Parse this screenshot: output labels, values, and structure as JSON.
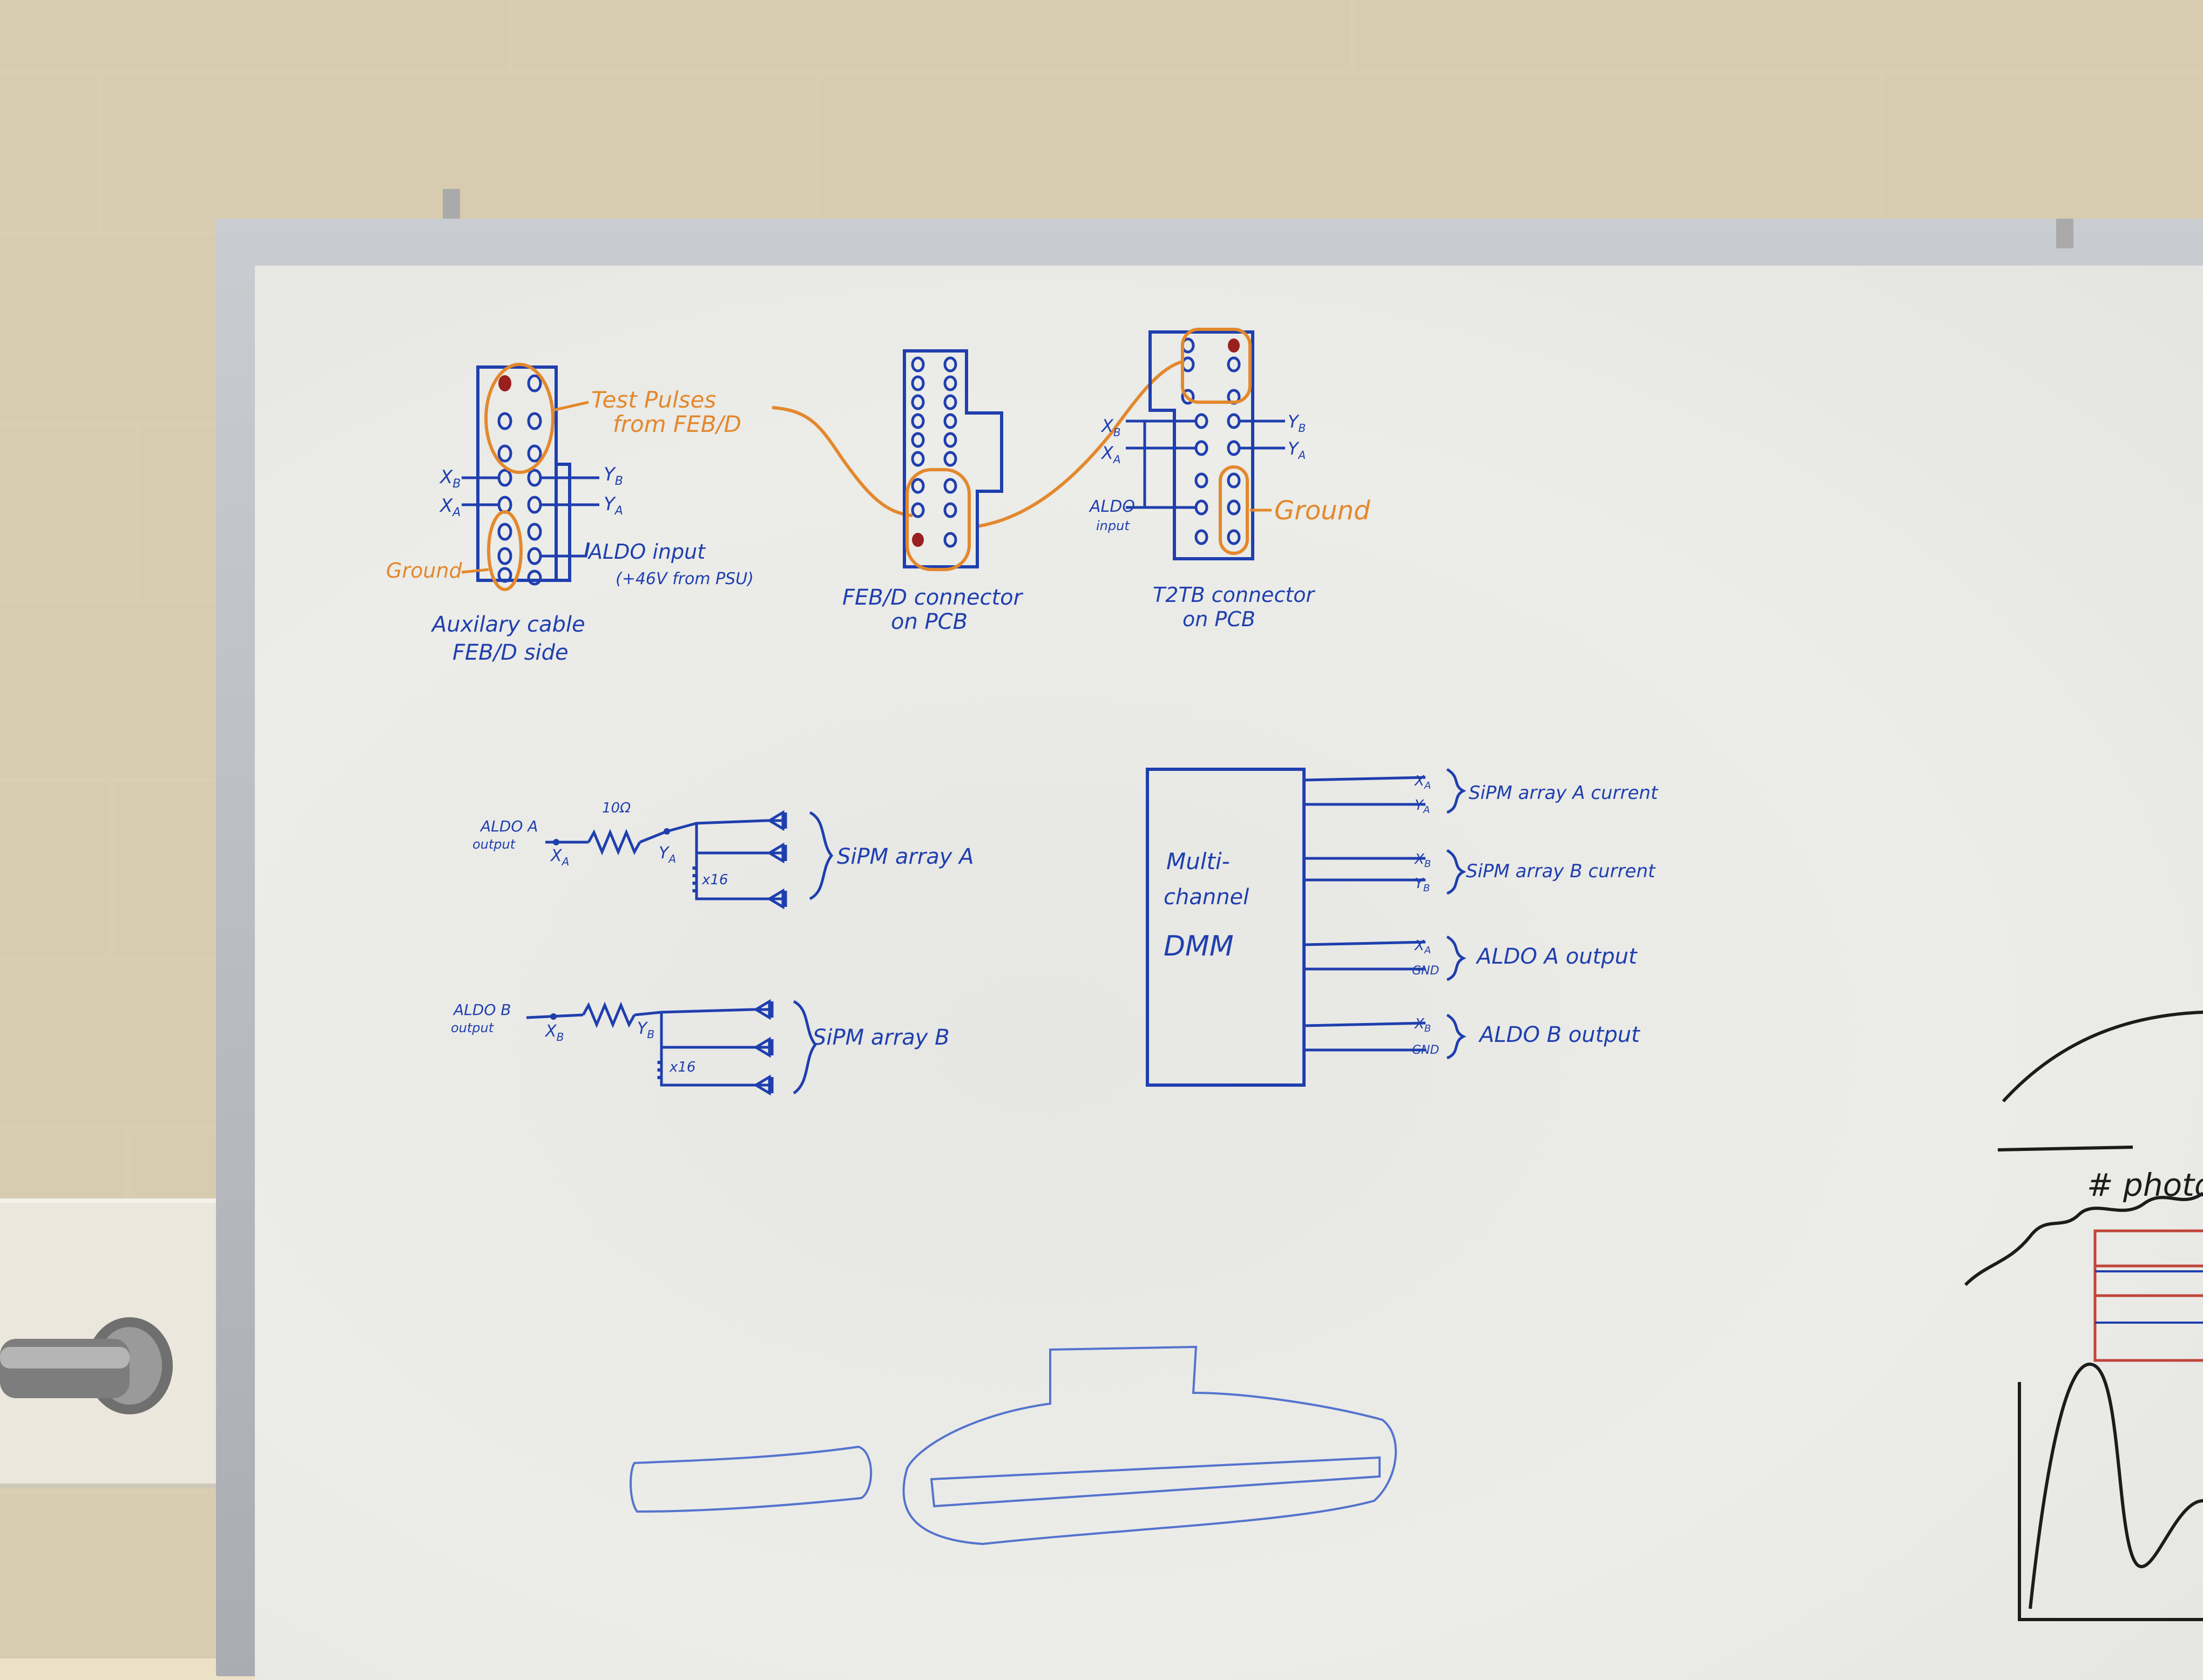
{
  "colors": {
    "blue_marker": "#1f3fae",
    "orange_marker": "#e3882c",
    "red_pin": "#9a1f1f",
    "black_marker": "#1c1c1c",
    "red_marker": "#c0453a"
  },
  "connectors": {
    "auxiliary": {
      "title_line1": "Auxilary cable",
      "title_line2": "FEB/D side",
      "xb": "X",
      "xb_sub": "B",
      "xa": "X",
      "xa_sub": "A",
      "yb": "Y",
      "yb_sub": "B",
      "ya": "Y",
      "ya_sub": "A",
      "aldo_input": "ALDO input",
      "aldo_input_note": "(+46V from PSU)",
      "ground": "Ground",
      "test_pulses_line1": "Test Pulses",
      "test_pulses_line2": "from FEB/D"
    },
    "febd": {
      "title_line1": "FEB/D connector",
      "title_line2": "on PCB"
    },
    "t2tb": {
      "title_line1": "T2TB connector",
      "title_line2": "on PCB",
      "xb": "X",
      "xb_sub": "B",
      "xa": "X",
      "xa_sub": "A",
      "yb": "Y",
      "yb_sub": "B",
      "ya": "Y",
      "ya_sub": "A",
      "aldo_input_line1": "ALDO",
      "aldo_input_line2": "input",
      "ground": "Ground"
    }
  },
  "circuit_a": {
    "source_line1": "ALDO A",
    "source_line2": "output",
    "resistor": "10Ω",
    "node1": "X",
    "node1_sub": "A",
    "node2": "Y",
    "node2_sub": "A",
    "multiplier": "x16",
    "label": "SiPM array A"
  },
  "circuit_b": {
    "source_line1": "ALDO B",
    "source_line2": "output",
    "node1": "X",
    "node1_sub": "B",
    "node2": "Y",
    "node2_sub": "B",
    "multiplier": "x16",
    "label": "SiPM array B"
  },
  "dmm": {
    "line1": "Multi-",
    "line2": "channel",
    "line3": "DMM",
    "channels": [
      {
        "top": "X",
        "top_sub": "A",
        "bottom": "Y",
        "bottom_sub": "A",
        "label": "SiPM array A current"
      },
      {
        "top": "X",
        "top_sub": "B",
        "bottom": "Y",
        "bottom_sub": "B",
        "label": "SiPM array B current"
      },
      {
        "top": "X",
        "top_sub": "A",
        "bottom": "GND",
        "bottom_sub": "",
        "label": "ALDO A output"
      },
      {
        "top": "X",
        "top_sub": "B",
        "bottom": "GND",
        "bottom_sub": "",
        "label": "ALDO B output"
      }
    ]
  },
  "right_edge": {
    "photons_label": "# photon"
  }
}
